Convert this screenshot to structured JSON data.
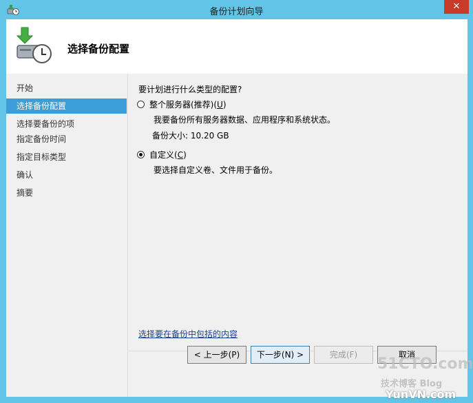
{
  "window": {
    "title": "备份计划向导",
    "close_glyph": "✕"
  },
  "header": {
    "title": "选择备份配置"
  },
  "sidebar": {
    "items": [
      {
        "label": "开始"
      },
      {
        "label": "选择备份配置"
      },
      {
        "label": "选择要备份的项"
      },
      {
        "label": "指定备份时间"
      },
      {
        "label": "指定目标类型"
      },
      {
        "label": "确认"
      },
      {
        "label": "摘要"
      }
    ],
    "active_index": 1
  },
  "main": {
    "question": "要计划进行什么类型的配置?",
    "option_full": {
      "label": "整个服务器(推荐)(",
      "accel": "U",
      "label_end": ")",
      "desc": "我要备份所有服务器数据、应用程序和系统状态。",
      "size": "备份大小: 10.20 GB",
      "selected": false
    },
    "option_custom": {
      "label": "自定义(",
      "accel": "C",
      "label_end": ")",
      "desc": "要选择自定义卷、文件用于备份。",
      "selected": true
    },
    "link": "选择要在备份中包括的内容"
  },
  "buttons": {
    "prev": "< 上一步(P)",
    "next": "下一步(N) >",
    "finish": "完成(F)",
    "cancel": "取消"
  },
  "watermark": {
    "line1": "51CTO.com",
    "line2": "技术博客",
    "line2b": "Blog",
    "line3": "YunVN.com"
  },
  "colors": {
    "title_bar": "#62c4e6",
    "selection": "#3d9dd8",
    "link": "#1a3f9a"
  }
}
